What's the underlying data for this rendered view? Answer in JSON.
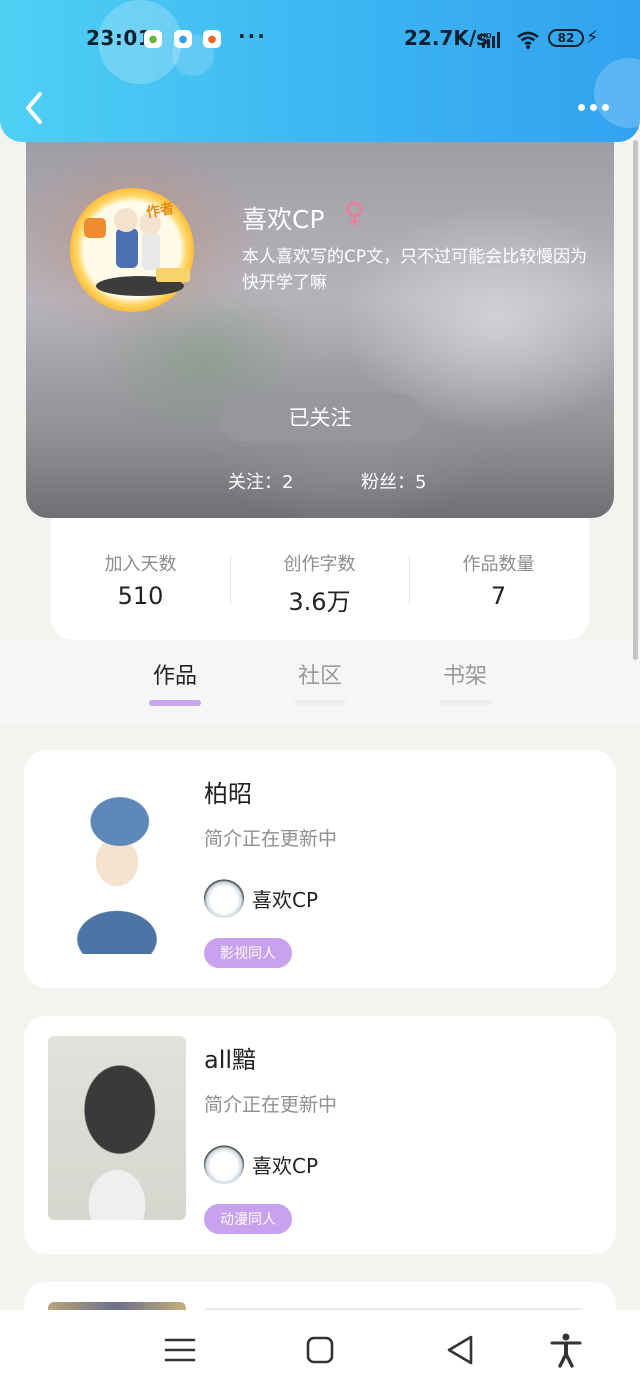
{
  "status_bar": {
    "time": "23:01",
    "more": "···",
    "net_speed": "22.7K/s",
    "signal_tag": "HD",
    "battery": "82"
  },
  "nav": {
    "back_icon": "chevron-left-icon",
    "menu_icon": "more-dots-icon"
  },
  "profile": {
    "author_badge": "作者",
    "nickname": "喜欢CP",
    "gender_symbol": "♀",
    "bio": "本人喜欢写的CP文，只不过可能会比较慢因为快开学了嘛",
    "follow_button": "已关注",
    "following_label": "关注：2",
    "followers_label": "粉丝：5"
  },
  "stats": [
    {
      "label": "加入天数",
      "value": "510"
    },
    {
      "label": "创作字数",
      "value": "3.6万"
    },
    {
      "label": "作品数量",
      "value": "7"
    }
  ],
  "tabs": [
    {
      "label": "作品",
      "active": true
    },
    {
      "label": "社区",
      "active": false
    },
    {
      "label": "书架",
      "active": false
    }
  ],
  "works": [
    {
      "title": "柏昭",
      "desc": "简介正在更新中",
      "author": "喜欢CP",
      "tag": "影视同人"
    },
    {
      "title": "all黯",
      "desc": "简介正在更新中",
      "author": "喜欢CP",
      "tag": "动漫同人"
    }
  ],
  "colors": {
    "topbar_start": "#4fd0f4",
    "topbar_end": "#31a2f0",
    "tag_purple": "#c8a2ef",
    "tab_indicator": "#c8a8ec",
    "gender_pink": "#f07a9a"
  }
}
